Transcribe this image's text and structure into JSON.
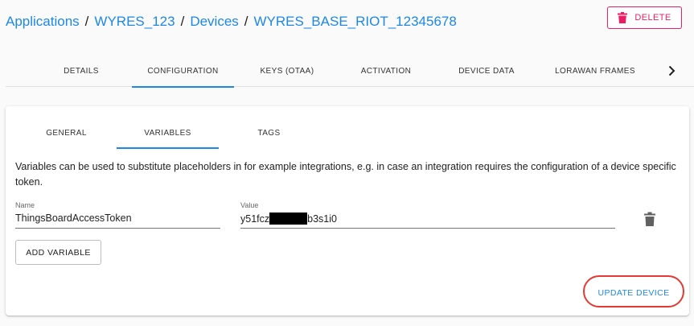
{
  "breadcrumb": {
    "items": [
      "Applications",
      "WYRES_123",
      "Devices",
      "WYRES_BASE_RIOT_12345678"
    ],
    "separator": "/"
  },
  "header": {
    "delete_label": "DELETE"
  },
  "top_tabs": {
    "items": [
      {
        "label": "DETAILS"
      },
      {
        "label": "CONFIGURATION"
      },
      {
        "label": "KEYS (OTAA)"
      },
      {
        "label": "ACTIVATION"
      },
      {
        "label": "DEVICE DATA"
      },
      {
        "label": "LORAWAN FRAMES"
      }
    ],
    "active": "CONFIGURATION",
    "more_icon": "chevron-right-icon"
  },
  "sub_tabs": {
    "items": [
      {
        "label": "GENERAL"
      },
      {
        "label": "VARIABLES"
      },
      {
        "label": "TAGS"
      }
    ],
    "active": "VARIABLES"
  },
  "variables": {
    "description": "Variables can be used to substitute placeholders in for example integrations, e.g. in case an integration requires the configuration of a device specific token.",
    "name_label": "Name",
    "value_label": "Value",
    "name_value": "ThingsBoardAccessToken",
    "value_prefix": "y51fcz",
    "value_suffix": "b3s1i0",
    "delete_icon": "trash-icon",
    "add_label": "ADD VARIABLE",
    "update_label": "UPDATE DEVICE"
  },
  "colors": {
    "primary": "#1e88e5",
    "danger": "#e91e63",
    "highlight": "#e53935"
  }
}
